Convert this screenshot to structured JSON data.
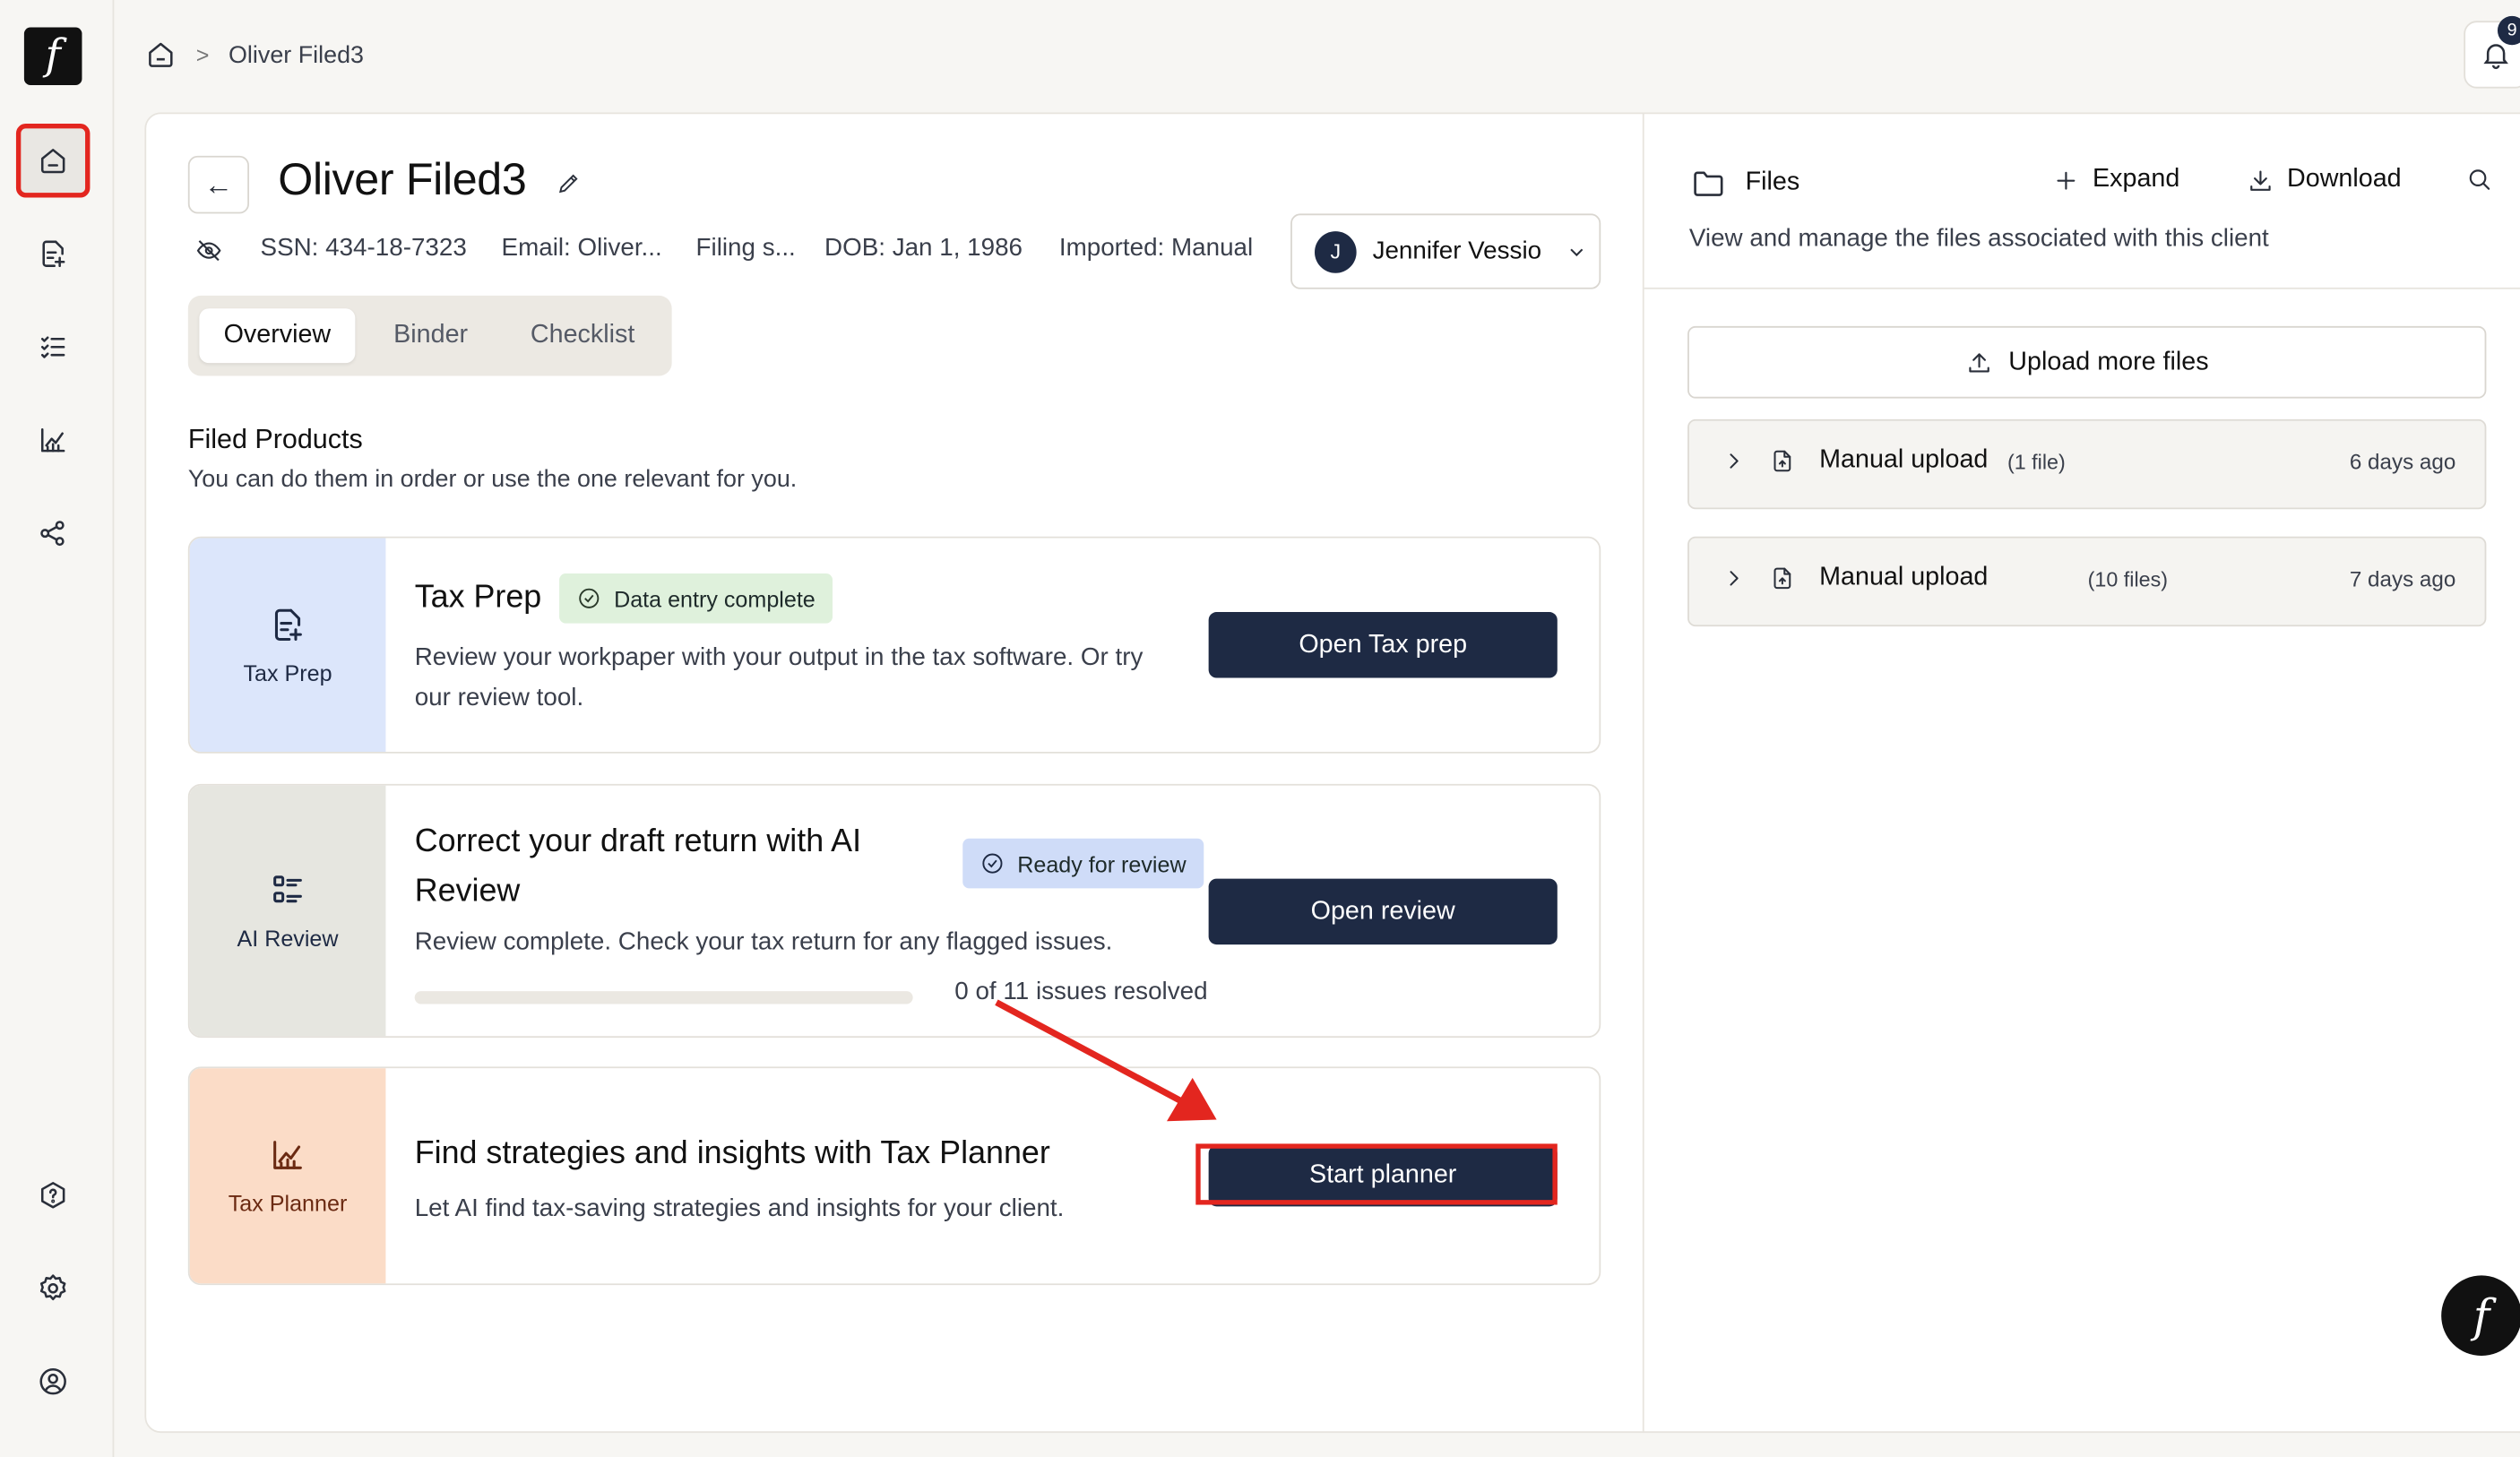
{
  "app": {
    "logo_glyph": "f"
  },
  "sidebar": {
    "items": [
      {
        "name": "home",
        "icon": "home-icon"
      },
      {
        "name": "tax-prep",
        "icon": "document-icon"
      },
      {
        "name": "checklist",
        "icon": "checklist-icon"
      },
      {
        "name": "charts",
        "icon": "chart-icon"
      },
      {
        "name": "share",
        "icon": "share-icon"
      }
    ],
    "bottom_items": [
      {
        "name": "help",
        "icon": "help-hexagon-icon"
      },
      {
        "name": "settings",
        "icon": "gear-icon"
      },
      {
        "name": "account",
        "icon": "user-circle-icon"
      }
    ]
  },
  "breadcrumb": {
    "current": "Oliver Filed3",
    "separator": ">"
  },
  "notifications": {
    "count": "9"
  },
  "client": {
    "name": "Oliver Filed3",
    "ssn": "SSN: 434-18-7323",
    "email": "Email: Oliver...",
    "filing": "Filing s...",
    "dob": "DOB: Jan 1, 1986",
    "imported": "Imported: Manual",
    "assignee_initial": "J",
    "assignee_name": "Jennifer Vessio"
  },
  "tabs": [
    "Overview",
    "Binder",
    "Checklist"
  ],
  "filed_products": {
    "title": "Filed Products",
    "subtitle": "You can do them in order or use the one relevant for you."
  },
  "cards": {
    "tax_prep": {
      "side_label": "Tax Prep",
      "title": "Tax Prep",
      "badge": "Data entry complete",
      "description": "Review your workpaper with your output in the tax software. Or try our review tool.",
      "button": "Open Tax prep"
    },
    "ai_review": {
      "side_label": "AI Review",
      "title": "Correct your draft return with AI Review",
      "badge": "Ready for review",
      "description": "Review complete. Check your tax return for any flagged issues.",
      "button": "Open review",
      "progress_text": "0 of 11 issues resolved",
      "progress_fraction": 0
    },
    "tax_planner": {
      "side_label": "Tax Planner",
      "title": "Find strategies and insights with Tax Planner",
      "description": "Let AI find tax-saving strategies and insights for your client.",
      "button": "Start planner"
    }
  },
  "files_panel": {
    "title": "Files",
    "expand": "Expand",
    "download": "Download",
    "subtitle": "View and manage the files associated with this client",
    "upload": "Upload more files",
    "groups": [
      {
        "name": "Manual upload",
        "count": "(1 file)",
        "time": "6 days ago"
      },
      {
        "name": "Manual upload",
        "count": "(10 files)",
        "time": "7 days ago"
      }
    ]
  },
  "colors": {
    "accent_dark": "#1e2a44",
    "annotation_red": "#e3261f",
    "badge_green": "#dff1dc",
    "badge_blue": "#cfdcf8",
    "tax_prep_side": "#dce6fb",
    "ai_review_side": "#e6e6e0",
    "tax_planner_side": "#fbdcc7"
  }
}
